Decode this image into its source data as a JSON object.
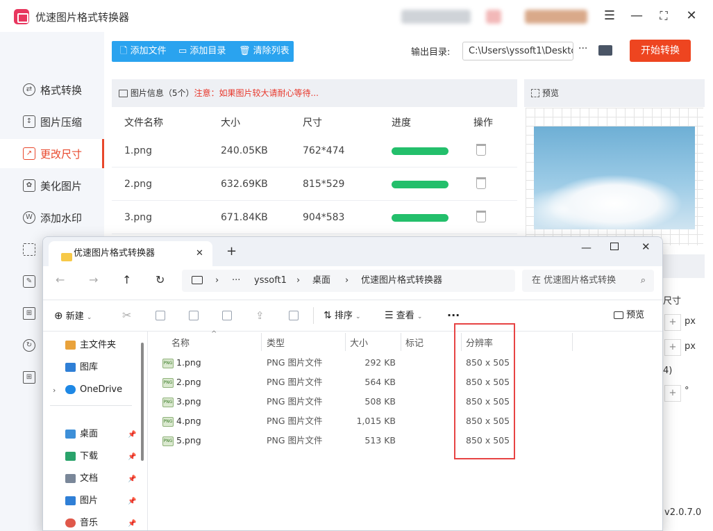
{
  "app": {
    "title": "优速图片格式转换器",
    "version": "v2.0.7.0"
  },
  "nav": {
    "items": [
      "格式转换",
      "图片压缩",
      "更改尺寸",
      "美化图片",
      "添加水印"
    ],
    "active_index": 2
  },
  "toolbar": {
    "add_file": "添加文件",
    "add_dir": "添加目录",
    "clear_list": "清除列表",
    "output_label": "输出目录:",
    "output_path": "C:\\Users\\yssoft1\\Deskto",
    "more": "···",
    "start": "开始转换"
  },
  "table": {
    "info": "图片信息（5个）",
    "notice": "注意：如果图片较大请耐心等待...",
    "headers": [
      "文件名称",
      "大小",
      "尺寸",
      "进度",
      "操作"
    ],
    "rows": [
      {
        "name": "1.png",
        "size": "240.05KB",
        "dim": "762*474",
        "progress": 1.0
      },
      {
        "name": "2.png",
        "size": "632.69KB",
        "dim": "815*529",
        "progress": 1.0
      },
      {
        "name": "3.png",
        "size": "671.84KB",
        "dim": "904*583",
        "progress": 1.0
      }
    ]
  },
  "preview": {
    "title": "预览",
    "size_label": "尺寸",
    "unit_px": "px",
    "paren": "4)",
    "degree": "°",
    "plus": "+"
  },
  "explorer": {
    "tab_title": "优速图片格式转换器",
    "new_tab": "+",
    "breadcrumb": [
      "yssoft1",
      "桌面",
      "优速图片格式转换器"
    ],
    "ellipsis": "···",
    "search_placeholder": "在 优速图片格式转换",
    "cmd": {
      "new": "新建",
      "sort": "排序",
      "view": "查看",
      "more": "···",
      "preview": "预览"
    },
    "sidebar": {
      "home": "主文件夹",
      "gallery": "图库",
      "onedrive": "OneDrive",
      "desktop": "桌面",
      "downloads": "下载",
      "documents": "文档",
      "pictures": "图片",
      "music": "音乐"
    },
    "columns": [
      "名称",
      "类型",
      "大小",
      "标记",
      "分辨率"
    ],
    "files": [
      {
        "name": "1.png",
        "type": "PNG 图片文件",
        "size": "292 KB",
        "res": "850 x 505"
      },
      {
        "name": "2.png",
        "type": "PNG 图片文件",
        "size": "564 KB",
        "res": "850 x 505"
      },
      {
        "name": "3.png",
        "type": "PNG 图片文件",
        "size": "508 KB",
        "res": "850 x 505"
      },
      {
        "name": "4.png",
        "type": "PNG 图片文件",
        "size": "1,015 KB",
        "res": "850 x 505"
      },
      {
        "name": "5.png",
        "type": "PNG 图片文件",
        "size": "513 KB",
        "res": "850 x 505"
      }
    ]
  },
  "colors": {
    "accent": "#e8472b",
    "blue": "#2aa3ef",
    "green": "#23bf6b",
    "highlight": "#e74343"
  }
}
